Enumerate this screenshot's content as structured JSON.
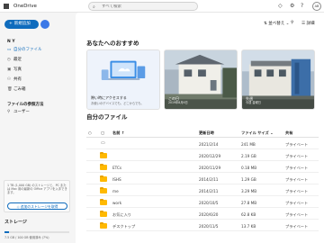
{
  "app": {
    "title": "OneDrive",
    "avatar_initials": "AB"
  },
  "search": {
    "placeholder": "すべて検索"
  },
  "topbar_icons": [
    "diamond-icon",
    "gear-icon",
    "help-icon"
  ],
  "sidebar": {
    "create_label": "新規追加",
    "section_user": "N Y",
    "items": [
      {
        "label": "自分のファイル",
        "icon": "folder-icon",
        "selected": true
      },
      {
        "label": "最近",
        "icon": "clock-icon"
      },
      {
        "label": "写真",
        "icon": "image-icon"
      },
      {
        "label": "共有",
        "icon": "people-icon"
      },
      {
        "label": "ごみ箱",
        "icon": "trash-icon"
      }
    ],
    "section_browse": "ファイルの参照方法",
    "browse_items": [
      {
        "label": "ユーザー",
        "icon": "person-icon"
      }
    ],
    "promo_text": "1 TB (1,000 GB) のストレージと、PC または Mac 用の最新の Office アプリを入手できます。",
    "promo_button": "追加のストレージを取得",
    "storage_title": "ストレージ",
    "storage_text": "7.5 GB / 100 GB 使用済み (7%)",
    "storage_fraction": 0.07
  },
  "main": {
    "sort_label": "並べ替え",
    "view_label": "詳細",
    "recommended_title": "あなたへのおすすめ",
    "cards": [
      {
        "title": "隙い時にアクセスする",
        "sub": "お使いのデバイスでも、どこからでも、"
      },
      {
        "title": "この日",
        "sub": "2019年8月6日"
      },
      {
        "title": "先週",
        "sub": "今週 金曜日"
      }
    ],
    "files_title": "自分のファイル",
    "columns": {
      "name": "名前",
      "modified": "更新日時",
      "size": "ファイル サイズ",
      "sharing": "共有"
    },
    "rows": [
      {
        "type": "file",
        "name": "",
        "modified": "2021/2/14",
        "size": "241 MB",
        "sharing": "プライベート"
      },
      {
        "type": "folder",
        "name": "",
        "modified": "2020/12/29",
        "size": "2.19 GB",
        "sharing": "プライベート"
      },
      {
        "type": "folder",
        "name": "ETCs",
        "modified": "2020/11/29",
        "size": "0.18 MB",
        "sharing": "プライベート"
      },
      {
        "type": "folder",
        "name": "ISHS",
        "modified": "2014/2/11",
        "size": "1.29 GB",
        "sharing": "プライベート"
      },
      {
        "type": "folder",
        "name": "me",
        "modified": "2014/2/11",
        "size": "3.29 MB",
        "sharing": "プライベート"
      },
      {
        "type": "folder",
        "name": "work",
        "modified": "2020/10/5",
        "size": "27.8 MB",
        "sharing": "プライベート"
      },
      {
        "type": "folder",
        "name": "お気に入り",
        "modified": "2020/6/20",
        "size": "62.8 KB",
        "sharing": "プライベート"
      },
      {
        "type": "folder",
        "name": "デスクトップ",
        "modified": "2020/11/5",
        "size": "13.7 KB",
        "sharing": "プライベート"
      }
    ]
  }
}
